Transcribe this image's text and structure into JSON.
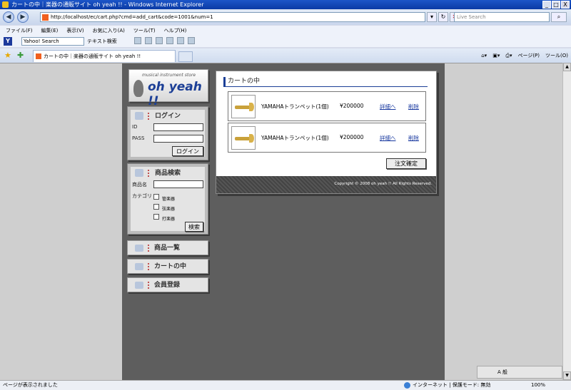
{
  "window": {
    "title": "カートの中｜楽器の通販サイト oh yeah !! - Windows Internet Explorer",
    "buttons": [
      "_",
      "□",
      "X"
    ]
  },
  "address_bar": {
    "url": "http://localhost/ec/cart.php?cmd=add_cart&code=1001&num=1",
    "search_placeholder": "Live Search"
  },
  "menu": [
    "ファイル(F)",
    "編集(E)",
    "表示(V)",
    "お気に入り(A)",
    "ツール(T)",
    "ヘルプ(H)"
  ],
  "toolbar": {
    "search_field": "Yahoo! Search",
    "text_search": "テキスト検索"
  },
  "tabs": [
    {
      "label": "カートの中｜楽器の通販サイト oh yeah !!"
    }
  ],
  "command_bar": {
    "page": "ページ(P)",
    "tools": "ツール(O)"
  },
  "site": {
    "logo": {
      "tagline": "musical instrument store",
      "brand": "oh yeah !!"
    },
    "login": {
      "title": "ログイン",
      "id_label": "ID",
      "pass_label": "PASS",
      "submit": "ログイン"
    },
    "product_search": {
      "title": "商品検索",
      "name_label": "商品名",
      "category_label": "カテゴリ",
      "categories": [
        "管楽器",
        "弦楽器",
        "打楽器"
      ],
      "submit": "検索"
    },
    "nav": [
      "商品一覧",
      "カートの中",
      "会員登録"
    ],
    "cart": {
      "title": "カートの中",
      "items": [
        {
          "name": "YAMAHAトランペット(1個)",
          "price": "¥200000",
          "detail": "詳細へ",
          "delete": "削除"
        },
        {
          "name": "YAMAHAトランペット(1個)",
          "price": "¥200000",
          "detail": "詳細へ",
          "delete": "削除"
        }
      ],
      "order_button": "注文確定",
      "copyright": "Copyright © 2008 oh yeah !! All Rights Reserved."
    }
  },
  "ime": {
    "mode": "A 般"
  },
  "status": {
    "text": "ページが表示されました",
    "zone": "インターネット | 保護モード: 無効",
    "zoom": "100%"
  }
}
